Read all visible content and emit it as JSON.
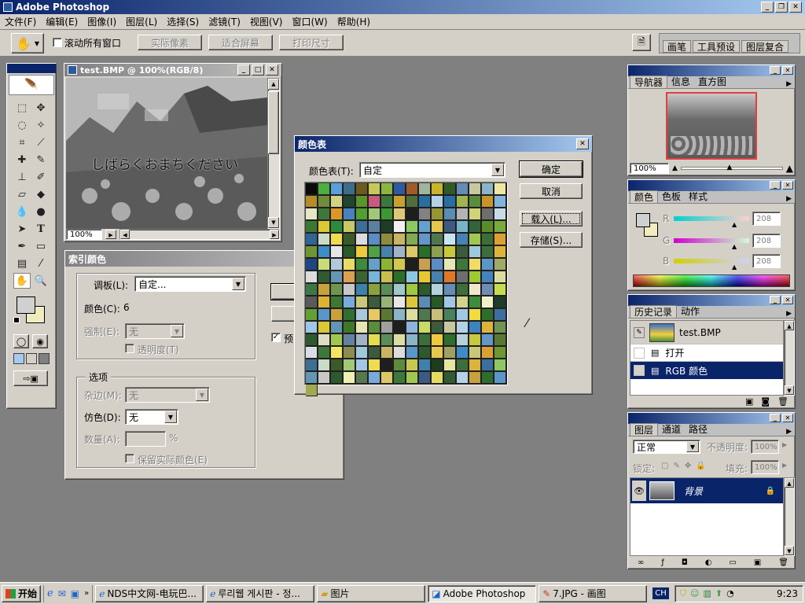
{
  "app": {
    "title": "Adobe Photoshop",
    "menu": [
      "文件(F)",
      "编辑(E)",
      "图像(I)",
      "图层(L)",
      "选择(S)",
      "滤镜(T)",
      "视图(V)",
      "窗口(W)",
      "帮助(H)"
    ],
    "options_bar": {
      "scroll_all": "滚动所有窗口",
      "actual_pixels": "实际像素",
      "fit_screen": "适合屏幕",
      "print_size": "打印尺寸",
      "well_tabs": [
        "画笔",
        "工具预设",
        "图层复合"
      ]
    }
  },
  "document": {
    "title": "test.BMP @ 100%(RGB/8)",
    "zoom": "100%",
    "overlay_text": "しばらくおまちください"
  },
  "index_dialog": {
    "title": "索引颜色",
    "palette_label": "调板(L):",
    "palette_value": "自定...",
    "colors_label": "颜色(C):",
    "colors_value": "6",
    "forced_label": "强制(E):",
    "forced_value": "无",
    "transparency_label": "透明度(T)",
    "options_title": "选项",
    "matte_label": "杂边(M):",
    "matte_value": "无",
    "dither_label": "仿色(D):",
    "dither_value": "无",
    "amount_label": "数量(A):",
    "amount_unit": "%",
    "preserve_label": "保留实际颜色(E)",
    "preview_label": "预"
  },
  "color_table_dialog": {
    "title": "颜色表",
    "table_label": "颜色表(T):",
    "table_value": "自定",
    "ok": "确定",
    "cancel": "取消",
    "load": "载入(L)...",
    "save": "存储(S)...",
    "palette": [
      "#0a0a0a",
      "#4cae3c",
      "#5aa0d8",
      "#3c6e8c",
      "#6e5a1e",
      "#c8c85a",
      "#8cb440",
      "#2e5aa0",
      "#a05a28",
      "#a0b4a0",
      "#c8b428",
      "#325a28",
      "#648cb4",
      "#c8c8a0",
      "#8cb4c8",
      "#f0e6a0",
      "#b48c28",
      "#6e8c3c",
      "#d2d282",
      "#1e4632",
      "#5a9628",
      "#c85a82",
      "#3c783c",
      "#c8a032",
      "#506e3c",
      "#286ea0",
      "#b4d2e6",
      "#286ea0",
      "#a0b450",
      "#5a8c3c",
      "#c89628",
      "#82b4dc",
      "#e6e6c8",
      "#3c783c",
      "#dc9628",
      "#4682be",
      "#50a030",
      "#a0c878",
      "#3c9632",
      "#dcc878",
      "#1e1e1e",
      "#828282",
      "#969632",
      "#5a8cb4",
      "#b4b4b4",
      "#d2d278",
      "#6e6e6e",
      "#c8dce6",
      "#3c7832",
      "#dcc832",
      "#2d8c3c",
      "#c8c864",
      "#3c6e96",
      "#5a82a0",
      "#1e3c28",
      "#f0f0f0",
      "#8cc864",
      "#64a0d2",
      "#e6c850",
      "#3c5a82",
      "#78b4c8",
      "#32643c",
      "#5a8c28",
      "#78aa3c",
      "#326496",
      "#c8dcc8",
      "#f0dc50",
      "#3c5a28",
      "#dcdcdc",
      "#5a8cc8",
      "#8c8c3c",
      "#c8b464",
      "#82aa50",
      "#6496c8",
      "#507850",
      "#c8e6f0",
      "#4682b4",
      "#a0c850",
      "#3c6e3c",
      "#dca032",
      "#6e9632",
      "#3c8cc8",
      "#e6e6e6",
      "#285a28",
      "#f0c83c",
      "#50a046",
      "#4682aa",
      "#a0b4c8",
      "#dcc864",
      "#286e28",
      "#8ca050",
      "#c8c83c",
      "#3c5a3c",
      "#a0c8dc",
      "#3c6e3c",
      "#dcb43c",
      "#1e4682",
      "#c8dc78",
      "#b4c8dc",
      "#e6dc64",
      "#3c8c3c",
      "#64a0c8",
      "#8cb432",
      "#d2c850",
      "#1e1e1e",
      "#c8a050",
      "#5a8cc8",
      "#e6e6b4",
      "#3c783c",
      "#f0dc64",
      "#5a96c8",
      "#a0aa64",
      "#dcdcdc",
      "#325a32",
      "#6496b4",
      "#dca050",
      "#3c6432",
      "#78b4dc",
      "#c8be50",
      "#2d6e2d",
      "#8cc8e6",
      "#e6c832",
      "#4682aa",
      "#dc7828",
      "#6e6e6e",
      "#a0c832",
      "#4682be",
      "#dcdca0",
      "#3c7846",
      "#c8a03c",
      "#6e9650",
      "#c8c8c8",
      "#3c82aa",
      "#8ca03c",
      "#5a8c5a",
      "#a0c8c8",
      "#a0c840",
      "#2d5a2d",
      "#b4d2dc",
      "#648cb4",
      "#3c6e3c",
      "#f0e6c8",
      "#6e8cb4",
      "#c8dc50",
      "#5a5a5a",
      "#dcb432",
      "#3c7832",
      "#78aadc",
      "#c8c878",
      "#3c5a3c",
      "#96b478",
      "#e6e6e6",
      "#dcc83c",
      "#5a8cb4",
      "#285a28",
      "#a0c8e6",
      "#d2d28c",
      "#3c8c3c",
      "#f0f0c8",
      "#1e3c28",
      "#64a032",
      "#5a96c8",
      "#c8a03c",
      "#326e32",
      "#aac8dc",
      "#e6c864",
      "#5a7832",
      "#8cb4c8",
      "#dcdca0",
      "#507850",
      "#c8be78",
      "#46825a",
      "#a0c8e6",
      "#f0dc3c",
      "#2d6e2d",
      "#3c6ea0",
      "#a0c8e6",
      "#dcc832",
      "#6496b4",
      "#3c7828",
      "#e6e6b4",
      "#5a8c3c",
      "#a0a0a0",
      "#1e1e1e",
      "#8cb4dc",
      "#c8dc64",
      "#3c5a3c",
      "#c8c8a0",
      "#b4d2e6",
      "#3c82be",
      "#dcb43c",
      "#6e9650",
      "#2d5a2d",
      "#dcdcc8",
      "#a0c850",
      "#6482a0",
      "#a0b4c8",
      "#e6dc50",
      "#5a8c5a",
      "#dcdca0",
      "#8cb4c8",
      "#3c6e3c",
      "#f0c83c",
      "#2d6e2d",
      "#b4d2dc",
      "#c8c83c",
      "#6496c8",
      "#5a7832",
      "#dcdce6",
      "#3c783c",
      "#f0e664",
      "#8c8c50",
      "#a0c8dc",
      "#3c5a3c",
      "#c8b464",
      "#dcdcdc",
      "#5a96c8",
      "#2d5a2d",
      "#e6c850",
      "#a0a064",
      "#3c8cc8",
      "#c8c878",
      "#dca032",
      "#6e9632",
      "#3c6e96",
      "#c8dcc8",
      "#3c5a28",
      "#a0c878",
      "#a0c8e6",
      "#f0dc50",
      "#1e1e1e",
      "#5a8c3c",
      "#c8c850",
      "#3c82aa",
      "#1e3c1e",
      "#e6e6a0",
      "#3c6e3c",
      "#dcb43c",
      "#3c6ea0",
      "#8cc864",
      "#6496b4",
      "#c8c8c8",
      "#2d5a2d",
      "#f0f0b4",
      "#5a7850",
      "#78aadc",
      "#dcc864",
      "#3c783c",
      "#a0c850",
      "#3c5a82",
      "#e6dc64",
      "#325a32",
      "#b4d2e6",
      "#c8a03c",
      "#2d6e2d",
      "#5a96c8",
      "#a0aa50"
    ]
  },
  "navigator": {
    "tabs": [
      "导航器",
      "信息",
      "直方图"
    ],
    "zoom": "100%"
  },
  "color_panel": {
    "tabs": [
      "颜色",
      "色板",
      "样式"
    ],
    "channels": [
      {
        "label": "R",
        "value": "208"
      },
      {
        "label": "G",
        "value": "208"
      },
      {
        "label": "B",
        "value": "208"
      }
    ]
  },
  "history_panel": {
    "tabs": [
      "历史记录",
      "动作"
    ],
    "snapshot": "test.BMP",
    "states": [
      "打开",
      "RGB 颜色"
    ]
  },
  "layers_panel": {
    "tabs": [
      "图层",
      "通道",
      "路径"
    ],
    "blend_mode": "正常",
    "opacity_label": "不透明度:",
    "opacity_value": "100%",
    "lock_label": "锁定:",
    "fill_label": "填充:",
    "fill_value": "100%",
    "layer_name": "背景"
  },
  "taskbar": {
    "start": "开始",
    "tasks": [
      "NDS中文网-电玩巴...",
      "루리웹 게시판 - 정...",
      "图片",
      "Adobe Photoshop",
      "7.JPG - 画图"
    ],
    "lang": "CH",
    "time": "9:23"
  },
  "colors": {
    "titlebar_active": "#0a246a",
    "titlebar_gradient_end": "#a6caf0",
    "workspace": "#808080",
    "face": "#d4d0c8",
    "selection": "#0a246a"
  }
}
